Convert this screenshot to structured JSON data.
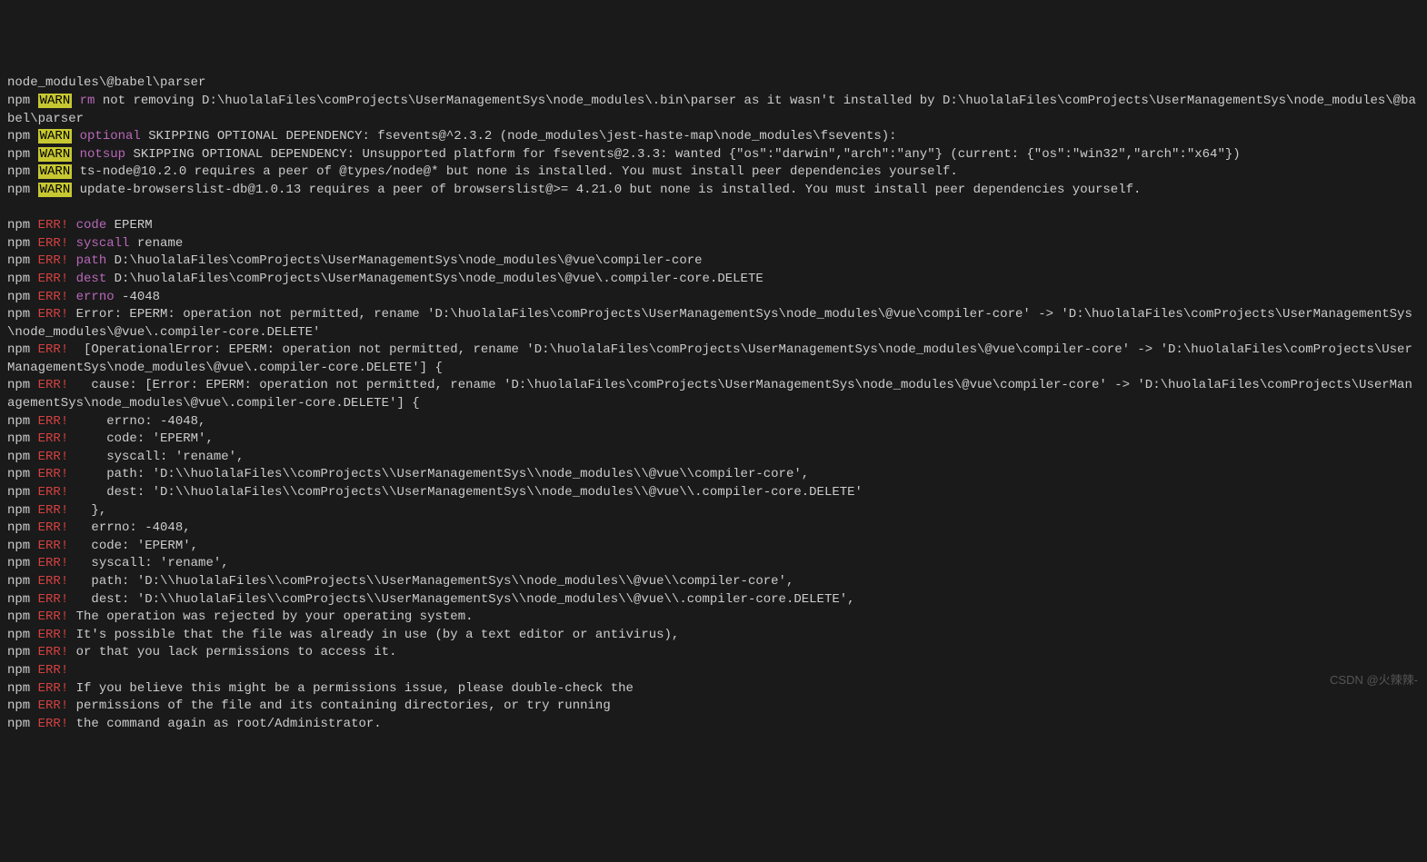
{
  "lines": [
    {
      "segments": [
        {
          "t": "node_modules\\@babel\\parser",
          "c": "dim"
        }
      ]
    },
    {
      "segments": [
        {
          "t": "npm ",
          "c": "npm"
        },
        {
          "t": "WARN",
          "c": "warn"
        },
        {
          "t": " ",
          "c": "npm"
        },
        {
          "t": "rm",
          "c": "tag-rm"
        },
        {
          "t": " not removing D:\\huolalaFiles\\comProjects\\UserManagementSys\\node_modules\\.bin\\parser as it wasn't installed by D:\\huolalaFiles\\comProjects\\UserManagementSys\\node_modules\\@babel\\parser",
          "c": "dim"
        }
      ]
    },
    {
      "segments": [
        {
          "t": "npm ",
          "c": "npm"
        },
        {
          "t": "WARN",
          "c": "warn"
        },
        {
          "t": " ",
          "c": "npm"
        },
        {
          "t": "optional",
          "c": "warn-code"
        },
        {
          "t": " SKIPPING OPTIONAL DEPENDENCY: fsevents@^2.3.2 (node_modules\\jest-haste-map\\node_modules\\fsevents):",
          "c": "dim"
        }
      ]
    },
    {
      "segments": [
        {
          "t": "npm ",
          "c": "npm"
        },
        {
          "t": "WARN",
          "c": "warn"
        },
        {
          "t": " ",
          "c": "npm"
        },
        {
          "t": "notsup",
          "c": "warn-code"
        },
        {
          "t": " SKIPPING OPTIONAL DEPENDENCY: Unsupported platform for fsevents@2.3.3: wanted {\"os\":\"darwin\",\"arch\":\"any\"} (current: {\"os\":\"win32\",\"arch\":\"x64\"})",
          "c": "dim"
        }
      ]
    },
    {
      "segments": [
        {
          "t": "npm ",
          "c": "npm"
        },
        {
          "t": "WARN",
          "c": "warn"
        },
        {
          "t": " ts-node@10.2.0 requires a peer of @types/node@* but none is installed. You must install peer dependencies yourself.",
          "c": "dim"
        }
      ]
    },
    {
      "segments": [
        {
          "t": "npm ",
          "c": "npm"
        },
        {
          "t": "WARN",
          "c": "warn"
        },
        {
          "t": " update-browserslist-db@1.0.13 requires a peer of browserslist@>= 4.21.0 but none is installed. You must install peer dependencies yourself.",
          "c": "dim"
        }
      ]
    },
    {
      "segments": [
        {
          "t": " ",
          "c": "dim"
        }
      ]
    },
    {
      "segments": [
        {
          "t": "npm ",
          "c": "npm"
        },
        {
          "t": "ERR!",
          "c": "err"
        },
        {
          "t": " ",
          "c": "npm"
        },
        {
          "t": "code",
          "c": "warn-code"
        },
        {
          "t": " EPERM",
          "c": "dim"
        }
      ]
    },
    {
      "segments": [
        {
          "t": "npm ",
          "c": "npm"
        },
        {
          "t": "ERR!",
          "c": "err"
        },
        {
          "t": " ",
          "c": "npm"
        },
        {
          "t": "syscall",
          "c": "warn-code"
        },
        {
          "t": " rename",
          "c": "dim"
        }
      ]
    },
    {
      "segments": [
        {
          "t": "npm ",
          "c": "npm"
        },
        {
          "t": "ERR!",
          "c": "err"
        },
        {
          "t": " ",
          "c": "npm"
        },
        {
          "t": "path",
          "c": "warn-code"
        },
        {
          "t": " D:\\huolalaFiles\\comProjects\\UserManagementSys\\node_modules\\@vue\\compiler-core",
          "c": "dim"
        }
      ]
    },
    {
      "segments": [
        {
          "t": "npm ",
          "c": "npm"
        },
        {
          "t": "ERR!",
          "c": "err"
        },
        {
          "t": " ",
          "c": "npm"
        },
        {
          "t": "dest",
          "c": "warn-code"
        },
        {
          "t": " D:\\huolalaFiles\\comProjects\\UserManagementSys\\node_modules\\@vue\\.compiler-core.DELETE",
          "c": "dim"
        }
      ]
    },
    {
      "segments": [
        {
          "t": "npm ",
          "c": "npm"
        },
        {
          "t": "ERR!",
          "c": "err"
        },
        {
          "t": " ",
          "c": "npm"
        },
        {
          "t": "errno",
          "c": "warn-code"
        },
        {
          "t": " -4048",
          "c": "dim"
        }
      ]
    },
    {
      "segments": [
        {
          "t": "npm ",
          "c": "npm"
        },
        {
          "t": "ERR!",
          "c": "err"
        },
        {
          "t": " Error: EPERM: operation not permitted, rename 'D:\\huolalaFiles\\comProjects\\UserManagementSys\\node_modules\\@vue\\compiler-core' -> 'D:\\huolalaFiles\\comProjects\\UserManagementSys\\node_modules\\@vue\\.compiler-core.DELETE'",
          "c": "dim"
        }
      ]
    },
    {
      "segments": [
        {
          "t": "npm ",
          "c": "npm"
        },
        {
          "t": "ERR!",
          "c": "err"
        },
        {
          "t": "  [OperationalError: EPERM: operation not permitted, rename 'D:\\huolalaFiles\\comProjects\\UserManagementSys\\node_modules\\@vue\\compiler-core' -> 'D:\\huolalaFiles\\comProjects\\UserManagementSys\\node_modules\\@vue\\.compiler-core.DELETE'] {",
          "c": "dim"
        }
      ]
    },
    {
      "segments": [
        {
          "t": "npm ",
          "c": "npm"
        },
        {
          "t": "ERR!",
          "c": "err"
        },
        {
          "t": "   cause: [Error: EPERM: operation not permitted, rename 'D:\\huolalaFiles\\comProjects\\UserManagementSys\\node_modules\\@vue\\compiler-core' -> 'D:\\huolalaFiles\\comProjects\\UserManagementSys\\node_modules\\@vue\\.compiler-core.DELETE'] {",
          "c": "dim"
        }
      ]
    },
    {
      "segments": [
        {
          "t": "npm ",
          "c": "npm"
        },
        {
          "t": "ERR!",
          "c": "err"
        },
        {
          "t": "     errno: -4048,",
          "c": "dim"
        }
      ]
    },
    {
      "segments": [
        {
          "t": "npm ",
          "c": "npm"
        },
        {
          "t": "ERR!",
          "c": "err"
        },
        {
          "t": "     code: 'EPERM',",
          "c": "dim"
        }
      ]
    },
    {
      "segments": [
        {
          "t": "npm ",
          "c": "npm"
        },
        {
          "t": "ERR!",
          "c": "err"
        },
        {
          "t": "     syscall: 'rename',",
          "c": "dim"
        }
      ]
    },
    {
      "segments": [
        {
          "t": "npm ",
          "c": "npm"
        },
        {
          "t": "ERR!",
          "c": "err"
        },
        {
          "t": "     path: 'D:\\\\huolalaFiles\\\\comProjects\\\\UserManagementSys\\\\node_modules\\\\@vue\\\\compiler-core',",
          "c": "dim"
        }
      ]
    },
    {
      "segments": [
        {
          "t": "npm ",
          "c": "npm"
        },
        {
          "t": "ERR!",
          "c": "err"
        },
        {
          "t": "     dest: 'D:\\\\huolalaFiles\\\\comProjects\\\\UserManagementSys\\\\node_modules\\\\@vue\\\\.compiler-core.DELETE'",
          "c": "dim"
        }
      ]
    },
    {
      "segments": [
        {
          "t": "npm ",
          "c": "npm"
        },
        {
          "t": "ERR!",
          "c": "err"
        },
        {
          "t": "   },",
          "c": "dim"
        }
      ]
    },
    {
      "segments": [
        {
          "t": "npm ",
          "c": "npm"
        },
        {
          "t": "ERR!",
          "c": "err"
        },
        {
          "t": "   errno: -4048,",
          "c": "dim"
        }
      ]
    },
    {
      "segments": [
        {
          "t": "npm ",
          "c": "npm"
        },
        {
          "t": "ERR!",
          "c": "err"
        },
        {
          "t": "   code: 'EPERM',",
          "c": "dim"
        }
      ]
    },
    {
      "segments": [
        {
          "t": "npm ",
          "c": "npm"
        },
        {
          "t": "ERR!",
          "c": "err"
        },
        {
          "t": "   syscall: 'rename',",
          "c": "dim"
        }
      ]
    },
    {
      "segments": [
        {
          "t": "npm ",
          "c": "npm"
        },
        {
          "t": "ERR!",
          "c": "err"
        },
        {
          "t": "   path: 'D:\\\\huolalaFiles\\\\comProjects\\\\UserManagementSys\\\\node_modules\\\\@vue\\\\compiler-core',",
          "c": "dim"
        }
      ]
    },
    {
      "segments": [
        {
          "t": "npm ",
          "c": "npm"
        },
        {
          "t": "ERR!",
          "c": "err"
        },
        {
          "t": "   dest: 'D:\\\\huolalaFiles\\\\comProjects\\\\UserManagementSys\\\\node_modules\\\\@vue\\\\.compiler-core.DELETE',",
          "c": "dim"
        }
      ]
    },
    {
      "segments": [
        {
          "t": "npm ",
          "c": "npm"
        },
        {
          "t": "ERR!",
          "c": "err"
        },
        {
          "t": " The operation was rejected by your operating system.",
          "c": "dim"
        }
      ]
    },
    {
      "segments": [
        {
          "t": "npm ",
          "c": "npm"
        },
        {
          "t": "ERR!",
          "c": "err"
        },
        {
          "t": " It's possible that the file was already in use (by a text editor or antivirus),",
          "c": "dim"
        }
      ]
    },
    {
      "segments": [
        {
          "t": "npm ",
          "c": "npm"
        },
        {
          "t": "ERR!",
          "c": "err"
        },
        {
          "t": " or that you lack permissions to access it.",
          "c": "dim"
        }
      ]
    },
    {
      "segments": [
        {
          "t": "npm ",
          "c": "npm"
        },
        {
          "t": "ERR!",
          "c": "err"
        }
      ]
    },
    {
      "segments": [
        {
          "t": "npm ",
          "c": "npm"
        },
        {
          "t": "ERR!",
          "c": "err"
        },
        {
          "t": " If you believe this might be a permissions issue, please double-check the",
          "c": "dim"
        }
      ]
    },
    {
      "segments": [
        {
          "t": "npm ",
          "c": "npm"
        },
        {
          "t": "ERR!",
          "c": "err"
        },
        {
          "t": " permissions of the file and its containing directories, or try running",
          "c": "dim"
        }
      ]
    },
    {
      "segments": [
        {
          "t": "npm ",
          "c": "npm"
        },
        {
          "t": "ERR!",
          "c": "err"
        },
        {
          "t": " the command again as root/Administrator.",
          "c": "dim"
        }
      ]
    }
  ],
  "watermark": "CSDN @火辣辣-"
}
